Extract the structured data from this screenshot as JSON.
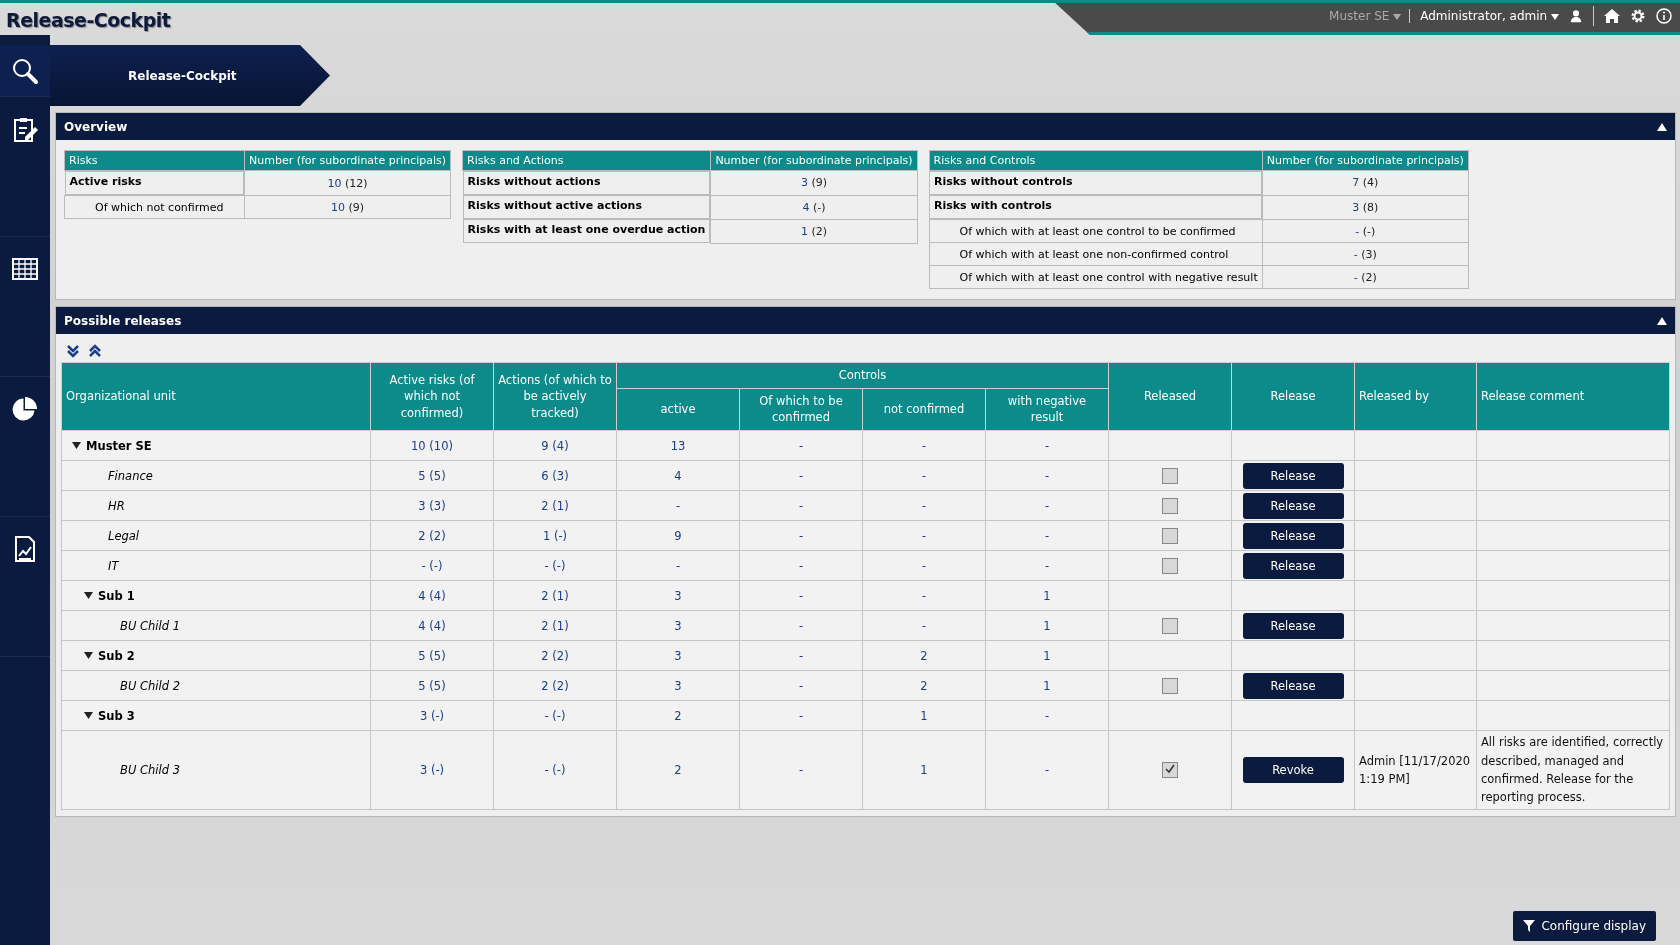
{
  "app_title": "Release-Cockpit",
  "top_bar": {
    "principal": "Muster SE",
    "user": "Administrator, admin"
  },
  "breadcrumb": "Release-Cockpit",
  "sidebar": [
    {
      "selected": true
    },
    {
      "selected": false
    },
    {
      "selected": false
    },
    {
      "selected": false
    },
    {
      "selected": false
    }
  ],
  "overview": {
    "title": "Overview",
    "expanded": true,
    "tables": [
      {
        "columns": [
          "Risks",
          "Number (for subordinate principals)"
        ],
        "rows": [
          {
            "label": "Active risks",
            "kind": "main",
            "value": "10",
            "sub": "(12)"
          },
          {
            "label": "Of which not confirmed",
            "kind": "sub",
            "value": "10",
            "sub": "(9)"
          }
        ]
      },
      {
        "columns": [
          "Risks and Actions",
          "Number (for subordinate principals)"
        ],
        "rows": [
          {
            "label": "Risks without actions",
            "kind": "main",
            "value": "3",
            "sub": "(9)"
          },
          {
            "label": "Risks without active actions",
            "kind": "main",
            "value": "4",
            "sub": "(-)"
          },
          {
            "label": "Risks with at least one overdue action",
            "kind": "main",
            "value": "1",
            "sub": "(2)"
          }
        ]
      },
      {
        "columns": [
          "Risks and Controls",
          "Number (for subordinate principals)"
        ],
        "rows": [
          {
            "label": "Risks without controls",
            "kind": "main",
            "value": "7",
            "sub": "(4)"
          },
          {
            "label": "Risks with controls",
            "kind": "main",
            "value": "3",
            "sub": "(8)"
          },
          {
            "label": "Of which with at least one control to be confirmed",
            "kind": "sub",
            "value": "-",
            "sub": "(-)"
          },
          {
            "label": "Of which with at least one non-confirmed control",
            "kind": "sub",
            "value": "-",
            "sub": "(3)"
          },
          {
            "label": "Of which with at least one control with negative result",
            "kind": "sub",
            "value": "-",
            "sub": "(2)"
          }
        ]
      }
    ]
  },
  "releases": {
    "title": "Possible releases",
    "expanded": true,
    "columns": {
      "org": "Organizational unit",
      "active_risks": "Active risks (of which not confirmed)",
      "actions": "Actions (of which to be actively tracked)",
      "controls": "Controls",
      "controls_sub": [
        "active",
        "Of which to be confirmed",
        "not confirmed",
        "with negative result"
      ],
      "released": "Released",
      "release": "Release",
      "released_by": "Released by",
      "comment": "Release comment"
    },
    "rows": [
      {
        "name": "Muster SE",
        "kind": "group",
        "expanded": true,
        "risks": "10 (10)",
        "actions": "9 (4)",
        "cells": [
          "13",
          "-",
          "-",
          "-"
        ],
        "children": [
          {
            "name": "Finance",
            "kind": "unit",
            "risks": "5 (5)",
            "actions": "6 (3)",
            "cells": [
              "4",
              "-",
              "-",
              "-"
            ],
            "released": false,
            "button": "Release"
          },
          {
            "name": "HR",
            "kind": "unit",
            "risks": "3 (3)",
            "actions": "2 (1)",
            "cells": [
              "-",
              "-",
              "-",
              "-"
            ],
            "released": false,
            "button": "Release"
          },
          {
            "name": "Legal",
            "kind": "unit",
            "risks": "2 (2)",
            "actions": "1 (-)",
            "cells": [
              "9",
              "-",
              "-",
              "-"
            ],
            "released": false,
            "button": "Release"
          },
          {
            "name": "IT",
            "kind": "unit",
            "risks": "- (-)",
            "actions": "- (-)",
            "cells": [
              "-",
              "-",
              "-",
              "-"
            ],
            "released": false,
            "button": "Release"
          },
          {
            "name": "Sub 1",
            "kind": "group",
            "expanded": true,
            "risks": "4 (4)",
            "actions": "2 (1)",
            "cells": [
              "3",
              "-",
              "-",
              "1"
            ],
            "children": [
              {
                "name": "BU Child 1",
                "kind": "unit",
                "risks": "4 (4)",
                "actions": "2 (1)",
                "cells": [
                  "3",
                  "-",
                  "-",
                  "1"
                ],
                "released": false,
                "button": "Release"
              }
            ]
          },
          {
            "name": "Sub 2",
            "kind": "group",
            "expanded": true,
            "risks": "5 (5)",
            "actions": "2 (2)",
            "cells": [
              "3",
              "-",
              "2",
              "1"
            ],
            "children": [
              {
                "name": "BU Child 2",
                "kind": "unit",
                "risks": "5 (5)",
                "actions": "2 (2)",
                "cells": [
                  "3",
                  "-",
                  "2",
                  "1"
                ],
                "released": false,
                "button": "Release"
              }
            ]
          },
          {
            "name": "Sub 3",
            "kind": "group",
            "expanded": true,
            "risks": "3 (-)",
            "actions": "- (-)",
            "cells": [
              "2",
              "-",
              "1",
              "-"
            ],
            "children": [
              {
                "name": "BU Child 3",
                "kind": "unit",
                "risks": "3 (-)",
                "actions": "- (-)",
                "cells": [
                  "2",
                  "-",
                  "1",
                  "-"
                ],
                "released": true,
                "button": "Revoke",
                "released_by": "Admin [11/17/2020 1:19 PM]",
                "comment": "All risks are identified, correctly described, managed and confirmed. Release for the reporting process."
              }
            ]
          }
        ]
      }
    ]
  },
  "configure_button": "Configure display"
}
